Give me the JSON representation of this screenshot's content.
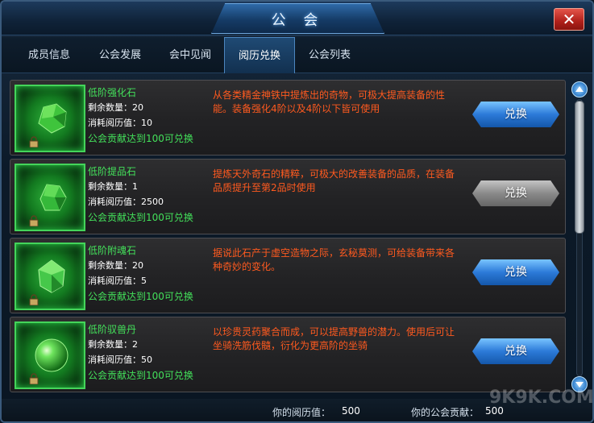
{
  "window": {
    "title": "公 会"
  },
  "tabs": [
    {
      "label": "成员信息"
    },
    {
      "label": "公会发展"
    },
    {
      "label": "会中见闻"
    },
    {
      "label": "阅历兑换"
    },
    {
      "label": "公会列表"
    }
  ],
  "active_tab": "阅历兑换",
  "items": [
    {
      "name": "低阶强化石",
      "qty": "剩余数量：20",
      "cost": "消耗阅历值：10",
      "requirement": "公会贡献达到100可兑换",
      "description": "从各类精金神铁中提炼出的奇物，可极大提高装备的性能。装备强化4阶以及4阶以下皆可使用",
      "button": "兑换",
      "button_state": "enabled",
      "icon": "green-ore-icon"
    },
    {
      "name": "低阶提品石",
      "qty": "剩余数量：1",
      "cost": "消耗阅历值：2500",
      "requirement": "公会贡献达到100可兑换",
      "description": "提炼天外奇石的精粹，可极大的改善装备的品质，在装备品质提升至第2品时使用",
      "button": "兑换",
      "button_state": "disabled",
      "icon": "green-ore-icon"
    },
    {
      "name": "低阶附魂石",
      "qty": "剩余数量：20",
      "cost": "消耗阅历值：5",
      "requirement": "公会贡献达到100可兑换",
      "description": "据说此石产于虚空造物之际，玄秘莫测，可给装备带来各种奇妙的变化。",
      "button": "兑换",
      "button_state": "enabled",
      "icon": "green-crystal-icon"
    },
    {
      "name": "低阶驭兽丹",
      "qty": "剩余数量：2",
      "cost": "消耗阅历值：50",
      "requirement": "公会贡献达到100可兑换",
      "description": "以珍贵灵药聚合而成，可以提高野兽的潜力。使用后可让坐骑洗筋伐髓，衍化为更高阶的坐骑",
      "button": "兑换",
      "button_state": "enabled",
      "icon": "green-orb-icon"
    }
  ],
  "footer": {
    "experience_label": "你的阅历值：",
    "experience_value": "500",
    "contribution_label": "你的公会贡献：",
    "contribution_value": "500"
  },
  "watermark": "9K9K.COM",
  "colors": {
    "item_name": "#43e05a",
    "description": "#ff5a1f",
    "button_enabled": "#2c7ad8",
    "button_disabled": "#8a8a8a"
  }
}
